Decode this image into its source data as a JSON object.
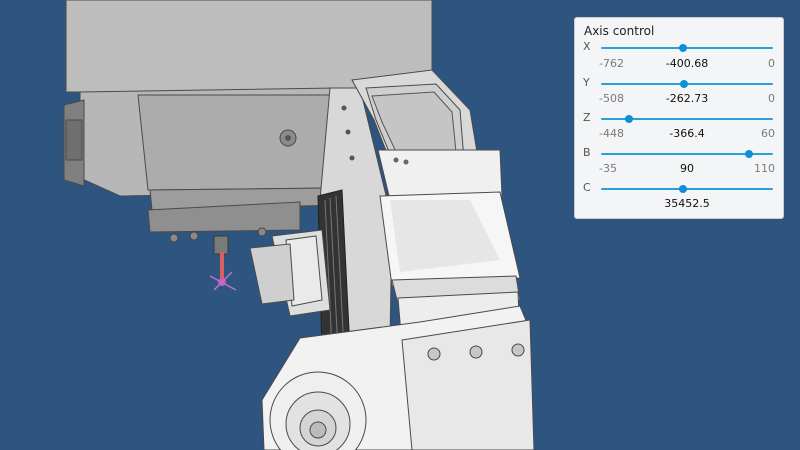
{
  "panel": {
    "title": "Axis control",
    "axes": [
      {
        "letter": "X",
        "min": "-762",
        "value": "-400.68",
        "max": "0",
        "fraction": 0.474
      },
      {
        "letter": "Y",
        "min": "-508",
        "value": "-262.73",
        "max": "0",
        "fraction": 0.483
      },
      {
        "letter": "Z",
        "min": "-448",
        "value": "-366.4",
        "max": "60",
        "fraction": 0.161
      },
      {
        "letter": "B",
        "min": "-35",
        "value": "90",
        "max": "110",
        "fraction": 0.862
      },
      {
        "letter": "C",
        "min": "",
        "value": "35452.5",
        "max": "",
        "fraction": 0.474
      }
    ]
  },
  "colors": {
    "background": "#2e5580",
    "accent": "#0e8fd6",
    "machine_body": "#b9b9b9",
    "machine_light": "#eeeeee"
  }
}
